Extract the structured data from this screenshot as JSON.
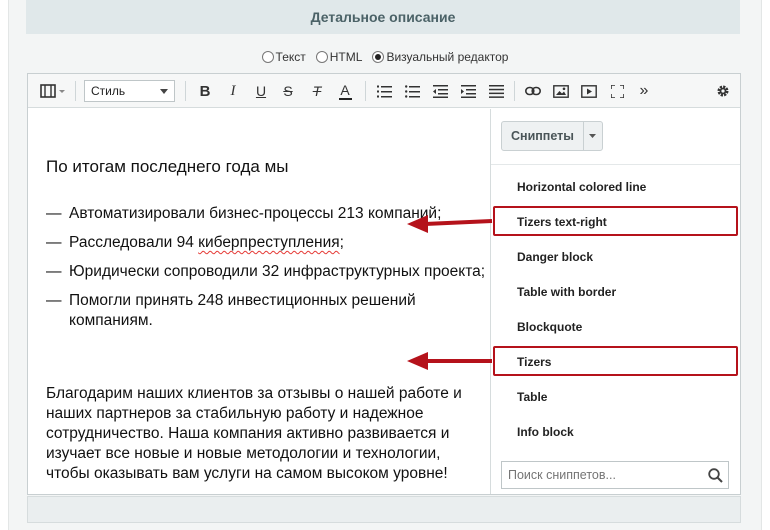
{
  "section": {
    "title": "Детальное описание"
  },
  "mode": {
    "options": [
      "Текст",
      "HTML",
      "Визуальный редактор"
    ],
    "selected": "Визуальный редактор"
  },
  "toolbar": {
    "style_label": "Стиль",
    "icons": [
      "layout-icon",
      "bold-icon",
      "italic-icon",
      "underline-icon",
      "strikethrough-icon",
      "clear-format-icon",
      "font-color-icon",
      "ordered-list-icon",
      "unordered-list-icon",
      "outdent-icon",
      "indent-icon",
      "align-justify-icon",
      "link-icon",
      "image-icon",
      "video-icon",
      "fullscreen-icon",
      "more-icon",
      "settings-icon"
    ],
    "bold": "B",
    "italic": "I",
    "underline": "U",
    "strike": "S",
    "clear": "T",
    "font_color": "A",
    "more": "»"
  },
  "content": {
    "intro": "По итогам последнего года мы",
    "dash": "—",
    "items": [
      "Автоматизировали бизнес-процессы 213 компаний;",
      "Расследовали 94 киберпреступления;",
      "Юридически сопроводили 32 инфраструктурных проекта;",
      "Помогли принять 248 инвестиционных решений компаниям."
    ],
    "item2_pre": "Расследовали 94 ",
    "item2_misspelled": "киберпреступления",
    "item2_post": ";",
    "outro": "Благодарим наших клиентов за отзывы о нашей работе и наших партнеров за стабильную работу и надежное сотрудничество. Наша компания активно развивается и изучает все новые и новые методологии и технологии, чтобы оказывать вам услуги на самом высоком уровне!"
  },
  "snippets": {
    "button_label": "Сниппеты",
    "items": [
      "Horizontal colored line",
      "Tizers text-right",
      "Danger block",
      "Table with border",
      "Blockquote",
      "Tizers",
      "Table",
      "Info block"
    ],
    "highlighted": [
      "Tizers text-right",
      "Tizers"
    ],
    "search_placeholder": "Поиск сниппетов..."
  },
  "colors": {
    "accent_red": "#b5121b",
    "header_bg": "#e0e8ea",
    "header_text": "#4b6267"
  }
}
